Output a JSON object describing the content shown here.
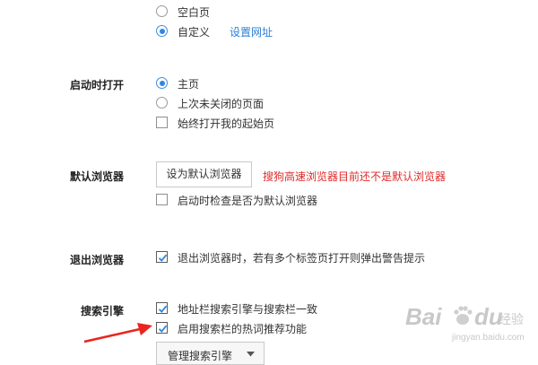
{
  "startup_page": {
    "options": [
      {
        "label": "空白页",
        "checked": false
      },
      {
        "label": "自定义",
        "checked": true
      }
    ],
    "set_url_link": "设置网址"
  },
  "open_on_start": {
    "label": "启动时打开",
    "options": [
      {
        "label": "主页",
        "checked": true
      },
      {
        "label": "上次未关闭的页面",
        "checked": false
      }
    ],
    "checkbox": {
      "label": "始终打开我的起始页",
      "checked": false
    }
  },
  "default_browser": {
    "label": "默认浏览器",
    "button": "设为默认浏览器",
    "warning": "搜狗高速浏览器目前还不是默认浏览器",
    "warning_color": "#e02a2a",
    "checkbox": {
      "label": "启动时检查是否为默认浏览器",
      "checked": false
    }
  },
  "exit_browser": {
    "label": "退出浏览器",
    "checkbox": {
      "label": "退出浏览器时，若有多个标签页打开则弹出警告提示",
      "checked": true
    }
  },
  "search_engine": {
    "label": "搜索引擎",
    "checkboxes": [
      {
        "label": "地址栏搜索引擎与搜索栏一致",
        "checked": true
      },
      {
        "label": "启用搜索栏的热词推荐功能",
        "checked": true
      }
    ],
    "manage_button": "管理搜索引擎"
  },
  "annotation": {
    "arrow_color": "#e8261f"
  },
  "watermark": {
    "main": "Bai",
    "paw": "du",
    "jingyan": "经验",
    "url": "jingyan.baidu.com"
  },
  "colors": {
    "accent": "#2f87e0",
    "link": "#2d7fd3"
  }
}
